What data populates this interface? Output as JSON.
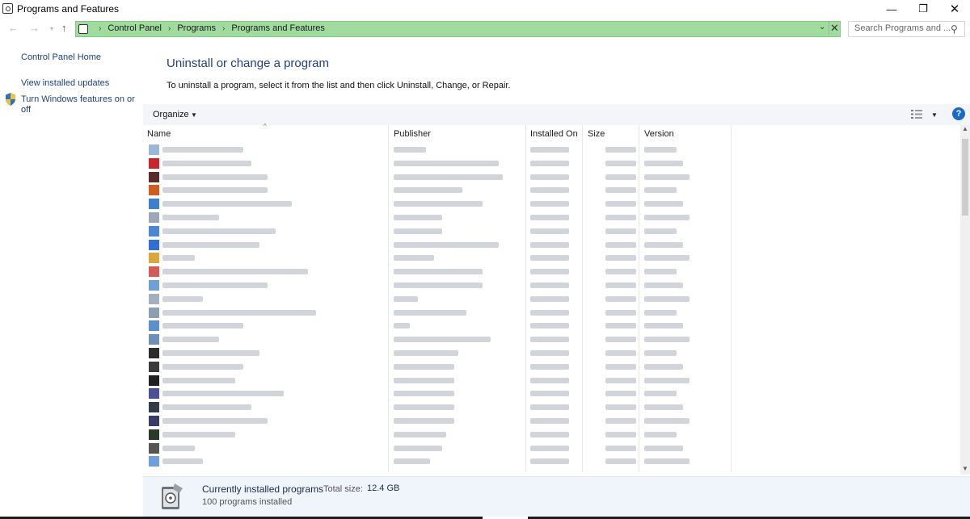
{
  "window": {
    "title": "Programs and Features",
    "minimize_glyph": "—",
    "maximize_glyph": "❐",
    "close_glyph": "✕"
  },
  "nav": {
    "back_glyph": "←",
    "forward_glyph": "→",
    "recent_glyph": "▾",
    "up_glyph": "↑",
    "breadcrumbs": [
      "Control Panel",
      "Programs",
      "Programs and Features"
    ],
    "separator": "›",
    "dropdown_glyph": "⌄",
    "clear_glyph": "✕",
    "search_placeholder": "Search Programs and ...",
    "search_glyph": "⚲",
    "address_color": "#9fdc9d"
  },
  "sidebar": {
    "home": "Control Panel Home",
    "updates": "View installed updates",
    "features": "Turn Windows features on or off"
  },
  "main": {
    "heading": "Uninstall or change a program",
    "instructions": "To uninstall a program, select it from the list and then click Uninstall, Change, or Repair."
  },
  "toolbar": {
    "organize": "Organize",
    "caret": "▼",
    "help": "?"
  },
  "columns": {
    "name": "Name",
    "publisher": "Publisher",
    "installed_on": "Installed On",
    "size": "Size",
    "version": "Version",
    "sort_glyph": "^"
  },
  "scroll": {
    "up_glyph": "▲",
    "down_glyph": "▼"
  },
  "details": {
    "title": "Currently installed programs",
    "total_size_label": "Total size:",
    "total_size_value": "12.4 GB",
    "count": "100 programs installed"
  }
}
